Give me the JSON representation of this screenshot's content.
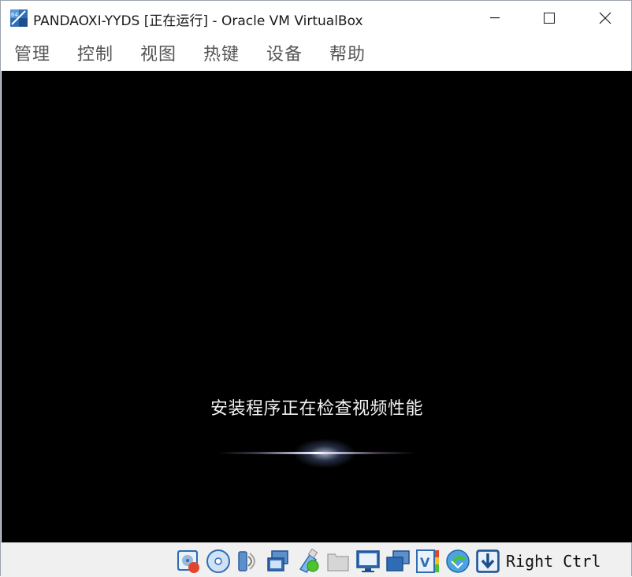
{
  "window": {
    "title": "PANDAOXI-YYDS [正在运行] - Oracle VM VirtualBox",
    "app_icon": "virtualbox-icon",
    "controls": [
      "minimize-icon",
      "maximize-icon",
      "close-icon"
    ]
  },
  "menubar": {
    "items": [
      {
        "label": "管理"
      },
      {
        "label": "控制"
      },
      {
        "label": "视图"
      },
      {
        "label": "热键"
      },
      {
        "label": "设备"
      },
      {
        "label": "帮助"
      }
    ]
  },
  "vm_screen": {
    "background_color": "#000000",
    "message": "安装程序正在检查视频性能"
  },
  "statusbar": {
    "icons": [
      "hard-disk-icon",
      "optical-drive-icon",
      "audio-icon",
      "network-icon",
      "usb-icon",
      "shared-folders-icon",
      "display-icon",
      "video-capture-icon",
      "virtualization-icon",
      "mouse-integration-icon",
      "keyboard-capture-icon"
    ],
    "host_key": "Right Ctrl"
  }
}
